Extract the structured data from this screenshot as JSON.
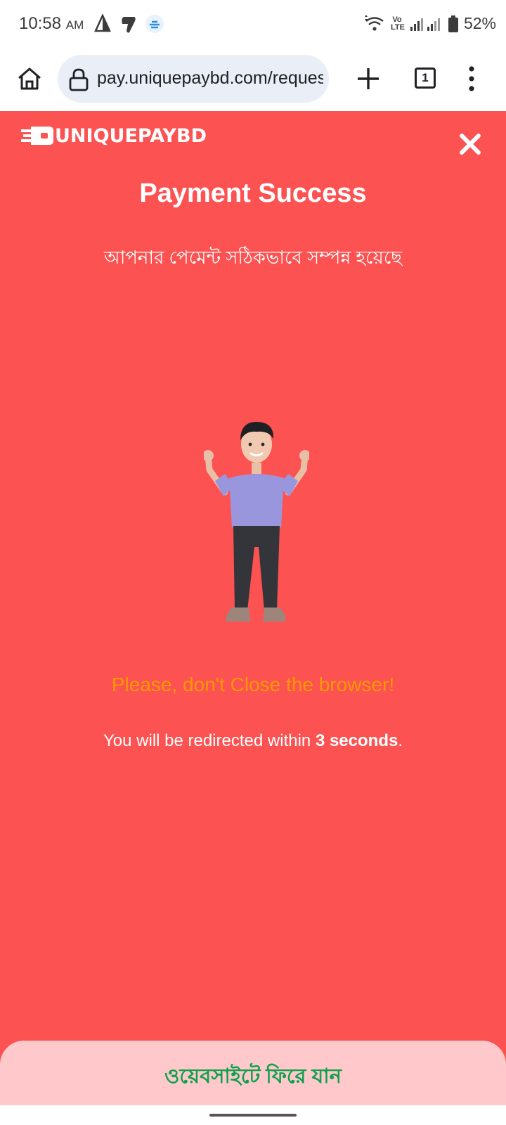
{
  "status_bar": {
    "time": "10:58",
    "ampm": "AM",
    "battery": "52%",
    "network_label": "Vo LTE"
  },
  "browser": {
    "url": "pay.uniquepaybd.com/request",
    "tab_count": "1"
  },
  "page": {
    "brand": "UNIQUEPAYBD",
    "title": "Payment Success",
    "subtitle": "আপনার পেমেন্ট সঠিকভাবে সম্পন্ন হয়েছে",
    "warning": "Please, don't Close the browser!",
    "redirect_prefix": "You will be redirected within ",
    "redirect_time": "3 seconds",
    "redirect_suffix": ".",
    "back_button": "ওয়েবসাইটে ফিরে যান"
  },
  "colors": {
    "page_background": "#fd5252",
    "warning_text": "#ff9900",
    "back_button_text": "#0ea14f",
    "bottom_sheet": "#ffc9cc"
  },
  "icons": [
    "home-icon",
    "lock-icon",
    "plus-icon",
    "tabs-icon",
    "more-vert-icon",
    "close-icon",
    "wifi-icon",
    "signal-icon",
    "battery-icon",
    "logo-icon"
  ]
}
